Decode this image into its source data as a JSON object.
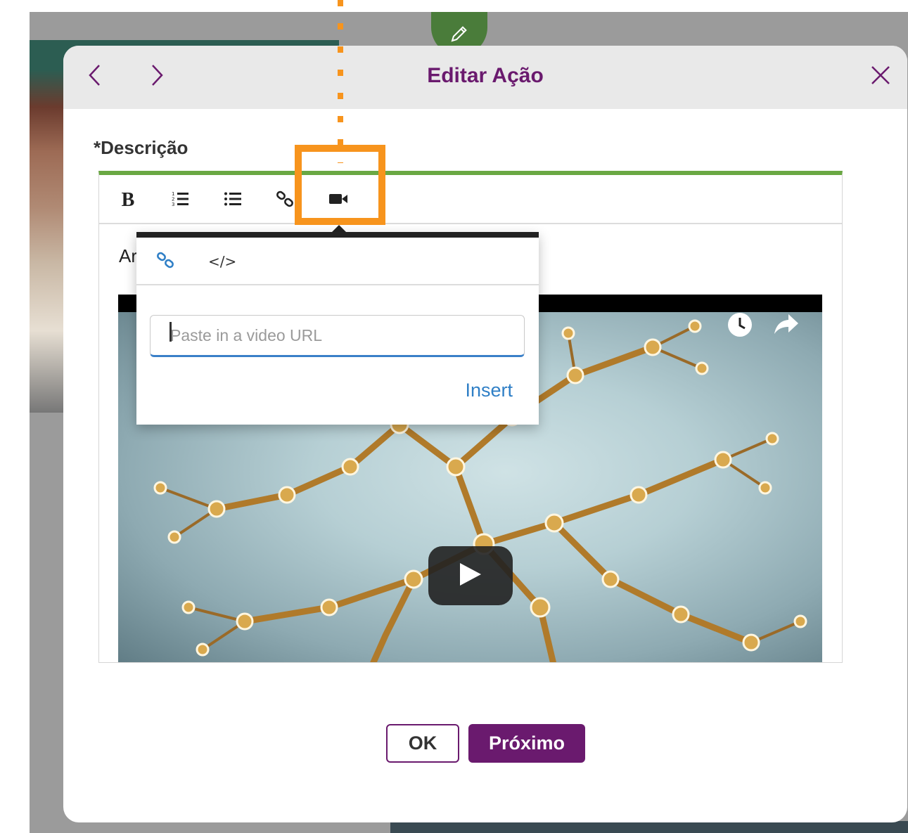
{
  "modal": {
    "title": "Editar Ação",
    "field_label": "*Descrição"
  },
  "editor": {
    "toolbar": {
      "bold_label": "B"
    },
    "partial_text": "Ar"
  },
  "video_popover": {
    "embed_tab_label": "</>",
    "url_placeholder": "Paste in a video URL",
    "insert_label": "Insert"
  },
  "footer": {
    "ok_label": "OK",
    "next_label": "Próximo"
  },
  "colors": {
    "brand_purple": "#6a1a6e",
    "editor_accent_green": "#6aa843",
    "annotation_orange": "#f7941d",
    "link_blue": "#2f7fc6"
  }
}
